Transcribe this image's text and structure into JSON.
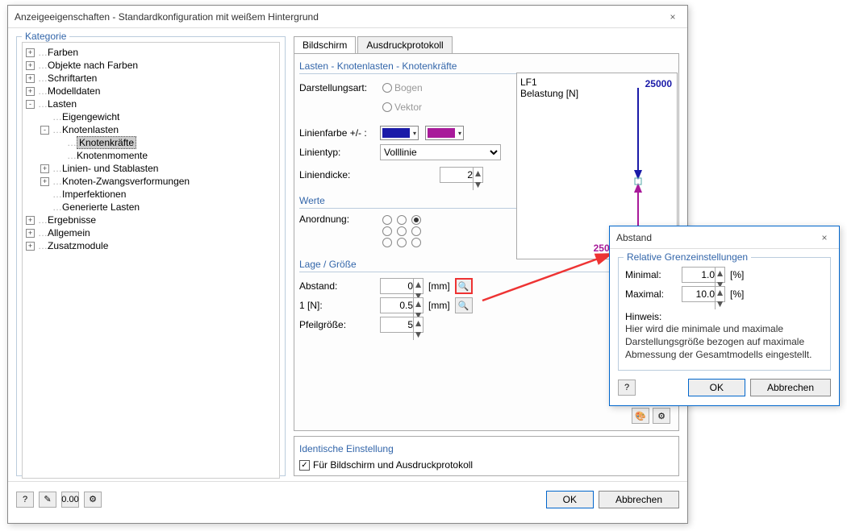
{
  "window": {
    "title": "Anzeigeeigenschaften - Standardkonfiguration mit weißem Hintergrund",
    "close": "×"
  },
  "category": {
    "label": "Kategorie",
    "items": [
      {
        "indent": 0,
        "exp": "+",
        "label": "Farben"
      },
      {
        "indent": 0,
        "exp": "+",
        "label": "Objekte nach Farben"
      },
      {
        "indent": 0,
        "exp": "+",
        "label": "Schriftarten"
      },
      {
        "indent": 0,
        "exp": "+",
        "label": "Modelldaten"
      },
      {
        "indent": 0,
        "exp": "-",
        "label": "Lasten"
      },
      {
        "indent": 1,
        "exp": "",
        "label": "Eigengewicht"
      },
      {
        "indent": 1,
        "exp": "-",
        "label": "Knotenlasten"
      },
      {
        "indent": 2,
        "exp": "",
        "label": "Knotenkräfte",
        "selected": true
      },
      {
        "indent": 2,
        "exp": "",
        "label": "Knotenmomente"
      },
      {
        "indent": 1,
        "exp": "+",
        "label": "Linien- und Stablasten"
      },
      {
        "indent": 1,
        "exp": "+",
        "label": "Knoten-Zwangsverformungen"
      },
      {
        "indent": 1,
        "exp": "",
        "label": "Imperfektionen"
      },
      {
        "indent": 1,
        "exp": "",
        "label": "Generierte Lasten"
      },
      {
        "indent": 0,
        "exp": "+",
        "label": "Ergebnisse"
      },
      {
        "indent": 0,
        "exp": "+",
        "label": "Allgemein"
      },
      {
        "indent": 0,
        "exp": "+",
        "label": "Zusatzmodule"
      }
    ]
  },
  "tabs": {
    "screen": "Bildschirm",
    "print": "Ausdruckprotokoll"
  },
  "panel": {
    "header": "Lasten - Knotenlasten - Knotenkräfte",
    "darstellung_label": "Darstellungsart:",
    "bogen": "Bogen",
    "vektor": "Vektor",
    "linienfarbe_label": "Linienfarbe +/- :",
    "color_plus": "#1a1aa8",
    "color_minus": "#a81a9a",
    "linientyp_label": "Linientyp:",
    "linientyp_value": "Volllinie",
    "liniendicke_label": "Liniendicke:",
    "liniendicke_value": "2",
    "werte_header": "Werte",
    "anordnung_label": "Anordnung:",
    "lage_header": "Lage / Größe",
    "abstand_label": "Abstand:",
    "abstand_value": "0",
    "unit_mm": "[mm]",
    "n1_label": "1 [N]:",
    "n1_value": "0.5",
    "pfeilgroesse_label": "Pfeilgröße:",
    "pfeilgroesse_value": "5"
  },
  "preview": {
    "lf1": "LF1",
    "belastung": "Belastung [N]",
    "val_top": "25000",
    "val_bottom": "25000"
  },
  "identical": {
    "header": "Identische Einstellung",
    "checkbox_label": "Für Bildschirm und Ausdruckprotokoll"
  },
  "buttons": {
    "ok": "OK",
    "cancel": "Abbrechen"
  },
  "subdialog": {
    "title": "Abstand",
    "group": "Relative Grenzeinstellungen",
    "minimal_label": "Minimal:",
    "minimal_value": "1.0",
    "maximal_label": "Maximal:",
    "maximal_value": "10.0",
    "pct": "[%]",
    "hinweis_label": "Hinweis:",
    "hinweis_text": "Hier wird die minimale und maximale Darstellungsgröße bezogen auf maximale Abmessung der Gesamtmodells eingestellt.",
    "ok": "OK",
    "cancel": "Abbrechen"
  }
}
